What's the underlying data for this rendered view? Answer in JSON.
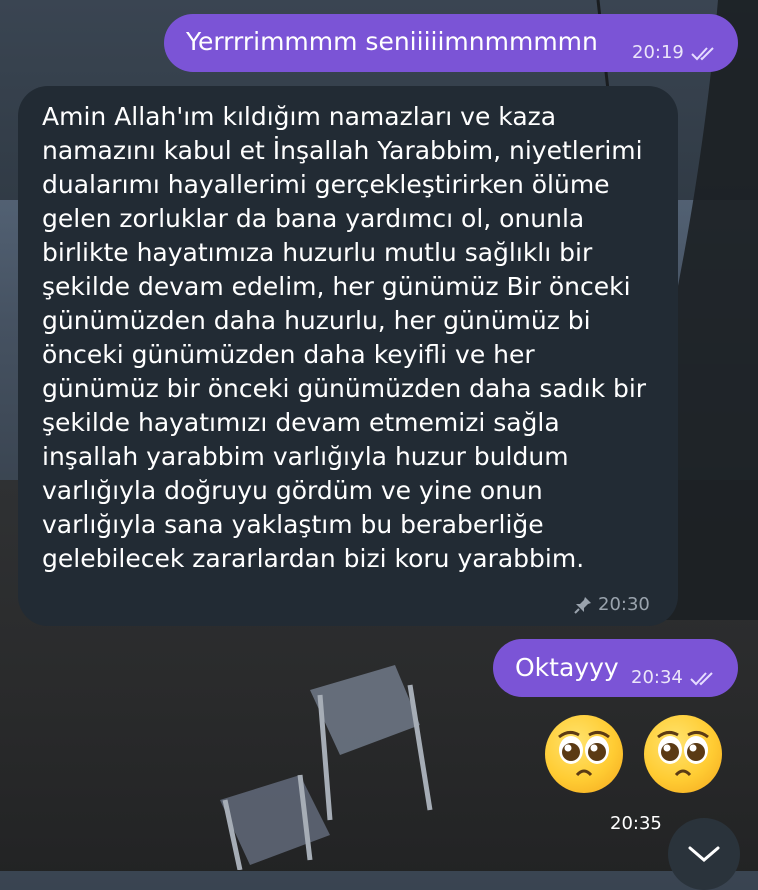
{
  "messages": [
    {
      "type": "outgoing",
      "text": "Yerrrrimmmm seniiiiimnmmmmn",
      "time": "20:19",
      "status_icon": "double-check-icon"
    },
    {
      "type": "incoming",
      "text": "Amin Allah'ım kıldığım namazları ve kaza namazını kabul et İnşallah Yarabbim, niyetlerimi dualarımı hayallerimi gerçekleştirirken ölüme gelen zorluklar da bana yardımcı ol, onunla birlikte hayatımıza huzurlu mutlu sağlıklı bir şekilde devam edelim, her günümüz Bir önceki günümüzden daha huzurlu, her günümüz bi önceki günümüzden daha keyifli ve her günümüz bir önceki günümüzden daha sadık bir şekilde hayatımızı devam etmemizi sağla inşallah yarabbim varlığıyla huzur buldum varlığıyla doğruyu gördüm ve yine onun varlığıyla sana yaklaştım bu beraberliğe gelebilecek zararlardan bizi koru yarabbim.",
      "time": "20:30",
      "pinned_icon": "pin-icon"
    },
    {
      "type": "outgoing",
      "text": "Oktayyy",
      "time": "20:34",
      "status_icon": "double-check-icon"
    },
    {
      "type": "emoji",
      "emojis": [
        "pleading-face",
        "pleading-face"
      ],
      "time": "20:35"
    }
  ],
  "scroll_down_icon": "chevron-down-icon",
  "colors": {
    "outgoing_bubble": "#7b54d6",
    "incoming_bubble": "#222b34",
    "text": "#ffffff",
    "meta_incoming": "#9aa3ad"
  }
}
